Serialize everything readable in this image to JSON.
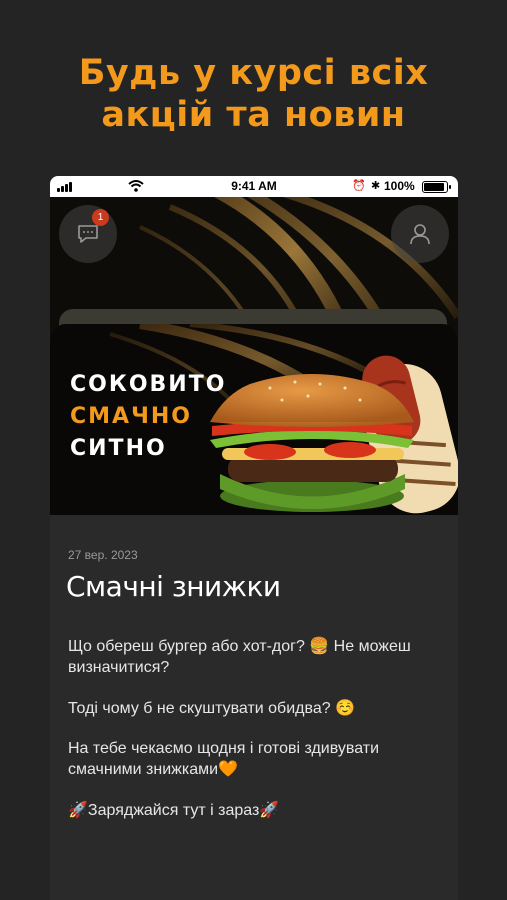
{
  "headline": {
    "line1": "Будь у курсі всіх",
    "line2": "акцій та новин"
  },
  "status_bar": {
    "time": "9:41 AM",
    "battery": "100%"
  },
  "header": {
    "message_badge": "1"
  },
  "banner": {
    "line1": "СОКОВИТО",
    "line2": "СМАЧНО",
    "line3": "СИТНО"
  },
  "post": {
    "date": "27 вер. 2023",
    "title": "Смачні знижки",
    "p1": "Що обереш бургер або хот-дог? 🍔 Не можеш визначитися?",
    "p2": "Тоді чому б не скуштувати обидва? ☺️",
    "p3": "На тебе чекаємо щодня і готові здивувати смачними знижками🧡",
    "p4": "🚀Заряджайся тут і зараз🚀"
  },
  "colors": {
    "accent": "#f39a1d",
    "background": "#242424",
    "card": "#2a2a2a"
  }
}
